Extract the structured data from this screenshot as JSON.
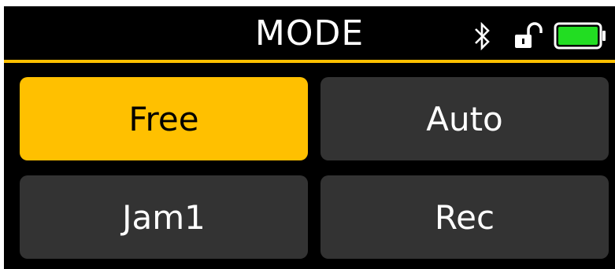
{
  "header": {
    "title": "MODE"
  },
  "status": {
    "bluetooth_icon": "bluetooth-icon",
    "lock_icon": "unlocked-padlock-icon",
    "battery_icon": "battery-icon",
    "battery_level": 1.0,
    "battery_color": "#22dd22"
  },
  "modes": [
    {
      "label": "Free",
      "selected": true
    },
    {
      "label": "Auto",
      "selected": false
    },
    {
      "label": "Jam1",
      "selected": false
    },
    {
      "label": "Rec",
      "selected": false
    }
  ],
  "colors": {
    "accent": "#ffc000",
    "button_bg": "#333333",
    "screen_bg": "#000000"
  }
}
